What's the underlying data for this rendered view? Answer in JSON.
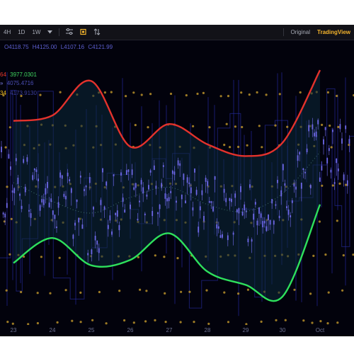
{
  "toolbar": {
    "intervals": [
      "4H",
      "1D",
      "1W"
    ],
    "interval_dropdown_icon": "caret-down-icon",
    "indicators_icon": "indicators-icon",
    "bar_style_icon": "candles-icon",
    "compare_icon": "compare-icon",
    "original_label": "Original",
    "tradingview_label": "TradingView"
  },
  "ohlc": {
    "open": "O4118.75",
    "high": "H4125.00",
    "low": "L4107.16",
    "close": "C4121.99"
  },
  "legend": [
    {
      "prefix": "64",
      "value": "3977.0301",
      "prefix_color": "#e8382e",
      "value_color": "#40d860"
    },
    {
      "prefix": "»",
      "value": "4075.4716",
      "prefix_color": "#7c7ee8",
      "value_color": "#4c4fb7"
    },
    {
      "prefix": "34",
      "value": "4173.9130",
      "prefix_color": "#f4c020",
      "value_color": "#3d3f9e"
    }
  ],
  "x_axis_labels": [
    "23",
    "24",
    "25",
    "26",
    "27",
    "28",
    "29",
    "30",
    "Oct"
  ],
  "colors": {
    "background": "#02020c",
    "upper_band": "#e4322c",
    "lower_band": "#2ee05c",
    "candles": "#6e68e8",
    "fill": "#0c2a3a",
    "dots": "#c49a2c",
    "midline": "#3e6e6a"
  },
  "chart_data": {
    "type": "line",
    "x": [
      "23",
      "24",
      "25",
      "26",
      "27",
      "28",
      "29",
      "30",
      "Oct"
    ],
    "series": [
      {
        "values": [
          4185,
          4192,
          4236,
          4152,
          4181,
          4155,
          4140,
          4157,
          4250
        ]
      },
      {
        "values": [
          4106,
          4082,
          4067,
          4087,
          4100,
          4078,
          4069,
          4092,
          4145
        ]
      },
      {
        "values": [
          4003,
          4035,
          4000,
          4007,
          4041,
          3992,
          3975,
          3960,
          4078
        ]
      }
    ]
  }
}
